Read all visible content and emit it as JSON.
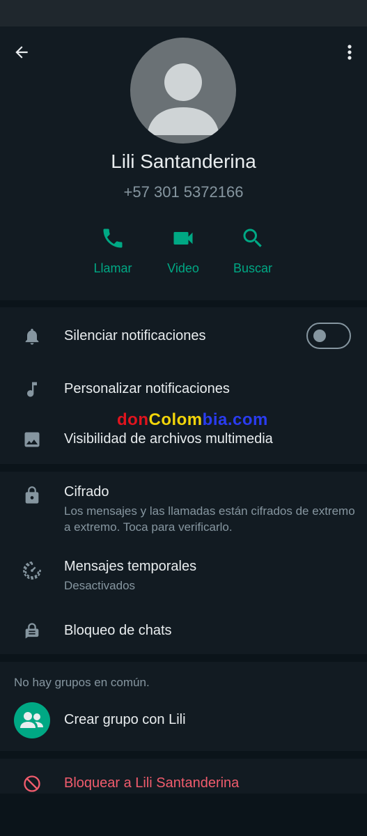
{
  "header": {
    "name": "Lili Santanderina",
    "phone": "+57 301 5372166",
    "actions": [
      {
        "label": "Llamar",
        "icon": "phone-icon"
      },
      {
        "label": "Video",
        "icon": "video-camera-icon"
      },
      {
        "label": "Buscar",
        "icon": "search-icon"
      }
    ]
  },
  "notifications": {
    "mute_label": "Silenciar notificaciones",
    "mute_enabled": false,
    "custom_label": "Personalizar notificaciones",
    "media_label": "Visibilidad de archivos multimedia"
  },
  "watermark": {
    "part1": "don",
    "part2": "Colom",
    "part3": "bia.com"
  },
  "privacy": {
    "encryption_title": "Cifrado",
    "encryption_sub": "Los mensajes y las llamadas están cifrados de extremo a extremo. Toca para verificarlo.",
    "temp_title": "Mensajes temporales",
    "temp_sub": "Desactivados",
    "lock_title": "Bloqueo de chats"
  },
  "groups": {
    "note": "No hay grupos en común.",
    "create_label": "Crear grupo con Lili"
  },
  "block": {
    "label": "Bloquear a Lili Santanderina"
  },
  "colors": {
    "accent": "#00a884",
    "danger": "#f15c6d",
    "background": "#0b141a",
    "panel": "#121b22"
  }
}
